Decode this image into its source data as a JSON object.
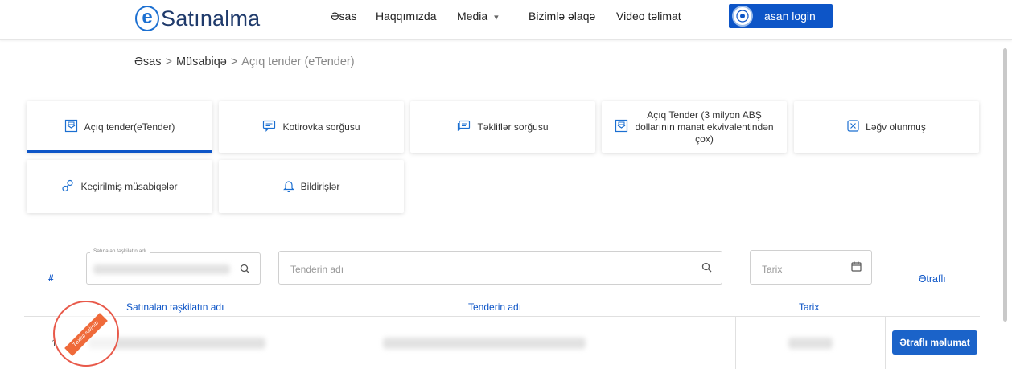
{
  "header": {
    "logo_letter": "e",
    "logo_text": "Satınalma",
    "nav": [
      "Əsas",
      "Haqqımızda",
      "Media",
      "Bizimlə əlaqə",
      "Video təlimat"
    ],
    "media_caret": "▾",
    "login_label": "asan login"
  },
  "breadcrumb": {
    "home": "Əsas",
    "section": "Müsabiqə",
    "current": "Açıq tender (eTender)",
    "separator": ">"
  },
  "cards": [
    {
      "label": "Açıq tender(eTender)",
      "icon": "envelope-icon",
      "active": true
    },
    {
      "label": "Kotirovka sorğusu",
      "icon": "chat-icon",
      "active": false
    },
    {
      "label": "Təkliflər sorğusu",
      "icon": "chat-icon",
      "active": false
    },
    {
      "label": "Açıq Tender (3 milyon ABŞ dollarının manat ekvivalentindən çox)",
      "line1": "Açıq Tender (3 milyon ABŞ",
      "line2": "dollarının manat ekvivalentindən",
      "line3": "çox)",
      "icon": "envelope-icon",
      "active": false
    },
    {
      "label": "Ləğv olunmuş",
      "icon": "close-box-icon",
      "active": false
    },
    {
      "label": "Keçirilmiş müsabiqələr",
      "icon": "link-icon",
      "active": false
    },
    {
      "label": "Bildirişlər",
      "icon": "bell-icon",
      "active": false
    }
  ],
  "filters": {
    "hash": "#",
    "org_legend": "Satınalan təşkilatın adı",
    "tender_placeholder": "Tenderin adı",
    "date_placeholder": "Tarix",
    "details_header": "Ətraflı"
  },
  "table": {
    "columns": [
      "Satınalan təşkilatın adı",
      "Tenderin adı",
      "Tarix"
    ],
    "rows": [
      {
        "num": "1",
        "stamp": "Təxirə salınıb",
        "button": "Ətraflı məlumat"
      }
    ]
  },
  "colors": {
    "accent": "#0d55c7",
    "stamp": "#e8594a"
  }
}
